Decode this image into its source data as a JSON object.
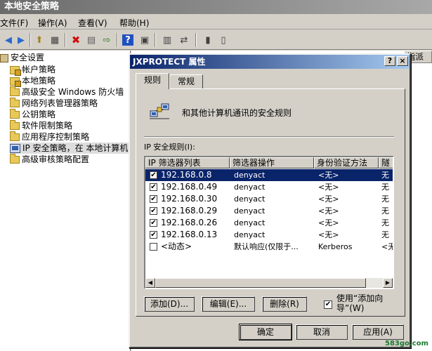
{
  "window": {
    "title": "本地安全策略"
  },
  "menu": [
    "文件(F)",
    "操作(A)",
    "查看(V)",
    "帮助(H)"
  ],
  "tree": {
    "root": "安全设置",
    "items": [
      "帐户策略",
      "本地策略",
      "高级安全 Windows 防火墙",
      "网络列表管理器策略",
      "公钥策略",
      "软件限制策略",
      "应用程序控制策略",
      "IP 安全策略，在 本地计算机",
      "高级审核策略配置"
    ]
  },
  "right_pane": {
    "column_fragment": "指派"
  },
  "dialog": {
    "title": "JXPROTECT 属性",
    "help_button": "?",
    "close_button": "×",
    "tabs": [
      "规则",
      "常规"
    ],
    "description": "和其他计算机通讯的安全规则",
    "list_label": "IP 安全规则(I):",
    "columns": [
      "IP 筛选器列表",
      "筛选器操作",
      "身份验证方法",
      "隧"
    ],
    "rows": [
      {
        "checked": true,
        "filter": "192.168.0.8",
        "action": "denyact",
        "auth": "<无>",
        "tunnel": "无",
        "selected": true
      },
      {
        "checked": true,
        "filter": "192.168.0.49",
        "action": "denyact",
        "auth": "<无>",
        "tunnel": "无",
        "selected": false
      },
      {
        "checked": true,
        "filter": "192.168.0.30",
        "action": "denyact",
        "auth": "<无>",
        "tunnel": "无",
        "selected": false
      },
      {
        "checked": true,
        "filter": "192.168.0.29",
        "action": "denyact",
        "auth": "<无>",
        "tunnel": "无",
        "selected": false
      },
      {
        "checked": true,
        "filter": "192.168.0.26",
        "action": "denyact",
        "auth": "<无>",
        "tunnel": "无",
        "selected": false
      },
      {
        "checked": true,
        "filter": "192.168.0.13",
        "action": "denyact",
        "auth": "<无>",
        "tunnel": "无",
        "selected": false
      },
      {
        "checked": false,
        "filter": "<动态>",
        "action": "默认响应(仅限于...",
        "auth": "Kerberos",
        "tunnel": "<无",
        "selected": false
      }
    ],
    "buttons": {
      "add": "添加(D)...",
      "edit": "编辑(E)...",
      "remove": "删除(R)"
    },
    "wizard_checkbox": {
      "checked": true,
      "label": "使用“添加向导”(W)"
    },
    "ok": "确定",
    "cancel": "取消",
    "apply": "应用(A)"
  },
  "watermark": "583go.com",
  "colors": {
    "selection": "#0a246a",
    "dialog_title": "#0a246a",
    "face": "#d4d0c8"
  }
}
